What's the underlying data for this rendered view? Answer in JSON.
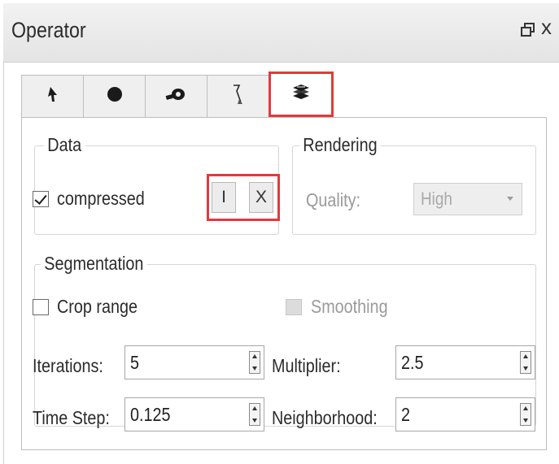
{
  "window": {
    "title": "Operator",
    "float_icon": "float-window-icon",
    "close_label": "x"
  },
  "tabs": [
    {
      "icon": "pointer-arrow-icon",
      "active": false
    },
    {
      "icon": "sphere-icon",
      "active": false
    },
    {
      "icon": "camera-icon",
      "active": false
    },
    {
      "icon": "brush-tool-icon",
      "active": false
    },
    {
      "icon": "layers-segmentation-icon",
      "active": true
    }
  ],
  "data_group": {
    "title": "Data",
    "compressed_label": "compressed",
    "compressed_checked": true,
    "import_button": "I",
    "export_button": "X"
  },
  "rendering_group": {
    "title": "Rendering",
    "quality_label": "Quality:",
    "quality_value": "High"
  },
  "segmentation_group": {
    "title": "Segmentation",
    "crop_range_label": "Crop range",
    "crop_range_checked": false,
    "smoothing_label": "Smoothing",
    "smoothing_checked": false,
    "iterations_label": "Iterations:",
    "iterations_value": "5",
    "multiplier_label": "Multiplier:",
    "multiplier_value": "2.5",
    "time_step_label": "Time Step:",
    "time_step_value": "0.125",
    "neighborhood_label": "Neighborhood:",
    "neighborhood_value": "2"
  },
  "colors": {
    "highlight": "#e23a3a",
    "titlebar": "#e8e8e8"
  }
}
